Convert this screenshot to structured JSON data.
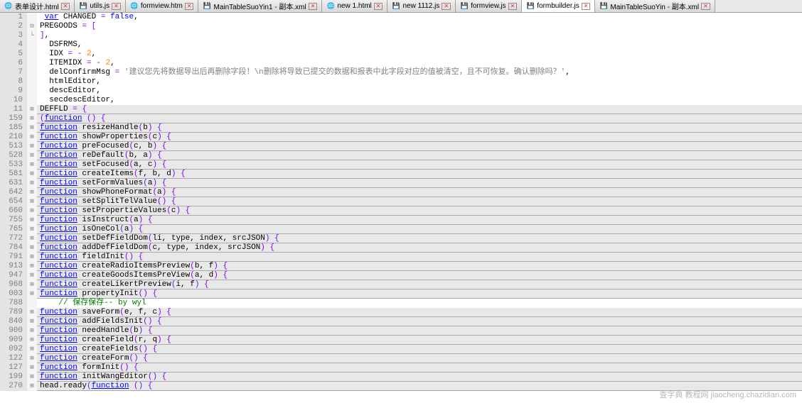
{
  "tabs": [
    {
      "label": "表单设计.html",
      "type": "html",
      "active": false
    },
    {
      "label": "utils.js",
      "type": "save",
      "active": false
    },
    {
      "label": "formview.htm",
      "type": "html",
      "active": false
    },
    {
      "label": "MainTableSuoYin1 - 副本.xml",
      "type": "save",
      "active": false
    },
    {
      "label": "new 1.html",
      "type": "html",
      "active": false
    },
    {
      "label": "new 1112.js",
      "type": "save",
      "active": false
    },
    {
      "label": "formview.js",
      "type": "save",
      "active": false
    },
    {
      "label": "formbuilder.js",
      "type": "save",
      "active": true
    },
    {
      "label": "MainTableSuoYin - 副本.xml",
      "type": "save",
      "active": false
    }
  ],
  "lines": [
    {
      "num": "1",
      "fold": "",
      "collapsed": false,
      "tokens": [
        {
          "t": " ",
          "c": ""
        },
        {
          "t": "var",
          "c": "kw2"
        },
        {
          "t": " CHANGED ",
          "c": ""
        },
        {
          "t": "=",
          "c": "op"
        },
        {
          "t": " ",
          "c": ""
        },
        {
          "t": "false",
          "c": "kw1"
        },
        {
          "t": ",",
          "c": ""
        }
      ]
    },
    {
      "num": "2",
      "fold": "⊟",
      "collapsed": false,
      "tokens": [
        {
          "t": "PREGOODS ",
          "c": ""
        },
        {
          "t": "=",
          "c": "op"
        },
        {
          "t": " ",
          "c": ""
        },
        {
          "t": "[",
          "c": "op"
        }
      ]
    },
    {
      "num": "3",
      "fold": "└",
      "collapsed": false,
      "tokens": [
        {
          "t": "]",
          "c": "op"
        },
        {
          "t": ",",
          "c": ""
        }
      ]
    },
    {
      "num": "4",
      "fold": "",
      "collapsed": false,
      "tokens": [
        {
          "t": "  DSFRMS,",
          "c": ""
        }
      ]
    },
    {
      "num": "5",
      "fold": "",
      "collapsed": false,
      "tokens": [
        {
          "t": "  IDX ",
          "c": ""
        },
        {
          "t": "=",
          "c": "op"
        },
        {
          "t": " ",
          "c": ""
        },
        {
          "t": "-",
          "c": "op"
        },
        {
          "t": " ",
          "c": ""
        },
        {
          "t": "2",
          "c": "num"
        },
        {
          "t": ",",
          "c": ""
        }
      ]
    },
    {
      "num": "6",
      "fold": "",
      "collapsed": false,
      "tokens": [
        {
          "t": "  ITEMIDX ",
          "c": ""
        },
        {
          "t": "=",
          "c": "op"
        },
        {
          "t": " ",
          "c": ""
        },
        {
          "t": "-",
          "c": "op"
        },
        {
          "t": " ",
          "c": ""
        },
        {
          "t": "2",
          "c": "num"
        },
        {
          "t": ",",
          "c": ""
        }
      ]
    },
    {
      "num": "7",
      "fold": "",
      "collapsed": false,
      "tokens": [
        {
          "t": "  delConfirmMsg ",
          "c": ""
        },
        {
          "t": "=",
          "c": "op"
        },
        {
          "t": " ",
          "c": ""
        },
        {
          "t": "'建议您先将数据导出后再删除字段！\\n删除将导致已提交的数据和报表中此字段对应的值被清空，且不可恢复。确认删除吗？'",
          "c": "str"
        },
        {
          "t": ",",
          "c": ""
        }
      ]
    },
    {
      "num": "8",
      "fold": "",
      "collapsed": false,
      "tokens": [
        {
          "t": "  htmlEditor,",
          "c": ""
        }
      ]
    },
    {
      "num": "9",
      "fold": "",
      "collapsed": false,
      "tokens": [
        {
          "t": "  descEditor,",
          "c": ""
        }
      ]
    },
    {
      "num": "10",
      "fold": "",
      "collapsed": false,
      "tokens": [
        {
          "t": "  secdescEditor,",
          "c": ""
        }
      ]
    },
    {
      "num": "11",
      "fold": "⊞",
      "collapsed": true,
      "tokens": [
        {
          "t": "DEFFLD ",
          "c": ""
        },
        {
          "t": "=",
          "c": "op"
        },
        {
          "t": " ",
          "c": ""
        },
        {
          "t": "{",
          "c": "op"
        }
      ]
    },
    {
      "num": "159",
      "fold": "⊞",
      "collapsed": true,
      "tokens": [
        {
          "t": "(",
          "c": "op"
        },
        {
          "t": "function",
          "c": "kw2"
        },
        {
          "t": " ",
          "c": ""
        },
        {
          "t": "()",
          "c": "op"
        },
        {
          "t": " ",
          "c": ""
        },
        {
          "t": "{",
          "c": "op"
        }
      ]
    },
    {
      "num": "185",
      "fold": "⊞",
      "collapsed": true,
      "tokens": [
        {
          "t": "function",
          "c": "kw2"
        },
        {
          "t": " resizeHandle",
          "c": ""
        },
        {
          "t": "(",
          "c": "op"
        },
        {
          "t": "b",
          "c": ""
        },
        {
          "t": ")",
          "c": "op"
        },
        {
          "t": " ",
          "c": ""
        },
        {
          "t": "{",
          "c": "op"
        }
      ]
    },
    {
      "num": "210",
      "fold": "⊞",
      "collapsed": true,
      "tokens": [
        {
          "t": "function",
          "c": "kw2"
        },
        {
          "t": " showProperties",
          "c": ""
        },
        {
          "t": "(",
          "c": "op"
        },
        {
          "t": "c",
          "c": ""
        },
        {
          "t": ")",
          "c": "op"
        },
        {
          "t": " ",
          "c": ""
        },
        {
          "t": "{",
          "c": "op"
        }
      ]
    },
    {
      "num": "513",
      "fold": "⊞",
      "collapsed": true,
      "tokens": [
        {
          "t": "function",
          "c": "kw2"
        },
        {
          "t": " preFocused",
          "c": ""
        },
        {
          "t": "(",
          "c": "op"
        },
        {
          "t": "c, b",
          "c": ""
        },
        {
          "t": ")",
          "c": "op"
        },
        {
          "t": " ",
          "c": ""
        },
        {
          "t": "{",
          "c": "op"
        }
      ]
    },
    {
      "num": "528",
      "fold": "⊞",
      "collapsed": true,
      "tokens": [
        {
          "t": "function",
          "c": "kw2"
        },
        {
          "t": " reDefault",
          "c": ""
        },
        {
          "t": "(",
          "c": "op"
        },
        {
          "t": "b, a",
          "c": ""
        },
        {
          "t": ")",
          "c": "op"
        },
        {
          "t": " ",
          "c": ""
        },
        {
          "t": "{",
          "c": "op"
        }
      ]
    },
    {
      "num": "533",
      "fold": "⊞",
      "collapsed": true,
      "tokens": [
        {
          "t": "function",
          "c": "kw2"
        },
        {
          "t": " setFocused",
          "c": ""
        },
        {
          "t": "(",
          "c": "op"
        },
        {
          "t": "a, c",
          "c": ""
        },
        {
          "t": ")",
          "c": "op"
        },
        {
          "t": " ",
          "c": ""
        },
        {
          "t": "{",
          "c": "op"
        }
      ]
    },
    {
      "num": "581",
      "fold": "⊞",
      "collapsed": true,
      "tokens": [
        {
          "t": "function",
          "c": "kw2"
        },
        {
          "t": " createItems",
          "c": ""
        },
        {
          "t": "(",
          "c": "op"
        },
        {
          "t": "f, b, d",
          "c": ""
        },
        {
          "t": ")",
          "c": "op"
        },
        {
          "t": " ",
          "c": ""
        },
        {
          "t": "{",
          "c": "op"
        }
      ]
    },
    {
      "num": "631",
      "fold": "⊞",
      "collapsed": true,
      "tokens": [
        {
          "t": "function",
          "c": "kw2"
        },
        {
          "t": " setFormValues",
          "c": ""
        },
        {
          "t": "(",
          "c": "op"
        },
        {
          "t": "a",
          "c": ""
        },
        {
          "t": ")",
          "c": "op"
        },
        {
          "t": " ",
          "c": ""
        },
        {
          "t": "{",
          "c": "op"
        }
      ]
    },
    {
      "num": "642",
      "fold": "⊞",
      "collapsed": true,
      "tokens": [
        {
          "t": "function",
          "c": "kw2"
        },
        {
          "t": " showPhoneFormat",
          "c": ""
        },
        {
          "t": "(",
          "c": "op"
        },
        {
          "t": "a",
          "c": ""
        },
        {
          "t": ")",
          "c": "op"
        },
        {
          "t": " ",
          "c": ""
        },
        {
          "t": "{",
          "c": "op"
        }
      ]
    },
    {
      "num": "654",
      "fold": "⊞",
      "collapsed": true,
      "tokens": [
        {
          "t": "function",
          "c": "kw2"
        },
        {
          "t": " setSplitTelValue",
          "c": ""
        },
        {
          "t": "()",
          "c": "op"
        },
        {
          "t": " ",
          "c": ""
        },
        {
          "t": "{",
          "c": "op"
        }
      ]
    },
    {
      "num": "660",
      "fold": "⊞",
      "collapsed": true,
      "tokens": [
        {
          "t": "function",
          "c": "kw2"
        },
        {
          "t": " setPropertieValues",
          "c": ""
        },
        {
          "t": "(",
          "c": "op"
        },
        {
          "t": "c",
          "c": ""
        },
        {
          "t": ")",
          "c": "op"
        },
        {
          "t": " ",
          "c": ""
        },
        {
          "t": "{",
          "c": "op"
        }
      ]
    },
    {
      "num": "755",
      "fold": "⊞",
      "collapsed": true,
      "tokens": [
        {
          "t": "function",
          "c": "kw2"
        },
        {
          "t": " isInstruct",
          "c": ""
        },
        {
          "t": "(",
          "c": "op"
        },
        {
          "t": "a",
          "c": ""
        },
        {
          "t": ")",
          "c": "op"
        },
        {
          "t": " ",
          "c": ""
        },
        {
          "t": "{",
          "c": "op"
        }
      ]
    },
    {
      "num": "765",
      "fold": "⊞",
      "collapsed": true,
      "tokens": [
        {
          "t": "function",
          "c": "kw2"
        },
        {
          "t": " isOneCol",
          "c": ""
        },
        {
          "t": "(",
          "c": "op"
        },
        {
          "t": "a",
          "c": ""
        },
        {
          "t": ")",
          "c": "op"
        },
        {
          "t": " ",
          "c": ""
        },
        {
          "t": "{",
          "c": "op"
        }
      ]
    },
    {
      "num": "772",
      "fold": "⊞",
      "collapsed": true,
      "tokens": [
        {
          "t": "function",
          "c": "kw2"
        },
        {
          "t": " setDefFieldDom",
          "c": ""
        },
        {
          "t": "(",
          "c": "op"
        },
        {
          "t": "li, type, index, srcJSON",
          "c": ""
        },
        {
          "t": ")",
          "c": "op"
        },
        {
          "t": " ",
          "c": ""
        },
        {
          "t": "{",
          "c": "op"
        }
      ]
    },
    {
      "num": "784",
      "fold": "⊞",
      "collapsed": true,
      "tokens": [
        {
          "t": "function",
          "c": "kw2"
        },
        {
          "t": " addDefFieldDom",
          "c": ""
        },
        {
          "t": "(",
          "c": "op"
        },
        {
          "t": "c, type, index, srcJSON",
          "c": ""
        },
        {
          "t": ")",
          "c": "op"
        },
        {
          "t": " ",
          "c": ""
        },
        {
          "t": "{",
          "c": "op"
        }
      ]
    },
    {
      "num": "791",
      "fold": "⊞",
      "collapsed": true,
      "tokens": [
        {
          "t": "function",
          "c": "kw2"
        },
        {
          "t": " fieldInit",
          "c": ""
        },
        {
          "t": "()",
          "c": "op"
        },
        {
          "t": " ",
          "c": ""
        },
        {
          "t": "{",
          "c": "op"
        }
      ]
    },
    {
      "num": "913",
      "fold": "⊞",
      "collapsed": true,
      "tokens": [
        {
          "t": "function",
          "c": "kw2"
        },
        {
          "t": " createRadioItemsPreview",
          "c": ""
        },
        {
          "t": "(",
          "c": "op"
        },
        {
          "t": "b, f",
          "c": ""
        },
        {
          "t": ")",
          "c": "op"
        },
        {
          "t": " ",
          "c": ""
        },
        {
          "t": "{",
          "c": "op"
        }
      ]
    },
    {
      "num": "947",
      "fold": "⊞",
      "collapsed": true,
      "tokens": [
        {
          "t": "function",
          "c": "kw2"
        },
        {
          "t": " createGoodsItemsPreView",
          "c": ""
        },
        {
          "t": "(",
          "c": "op"
        },
        {
          "t": "a, d",
          "c": ""
        },
        {
          "t": ")",
          "c": "op"
        },
        {
          "t": " ",
          "c": ""
        },
        {
          "t": "{",
          "c": "op"
        }
      ]
    },
    {
      "num": "968",
      "fold": "⊞",
      "collapsed": true,
      "tokens": [
        {
          "t": "function",
          "c": "kw2"
        },
        {
          "t": " createLikertPreview",
          "c": ""
        },
        {
          "t": "(",
          "c": "op"
        },
        {
          "t": "i, f",
          "c": ""
        },
        {
          "t": ")",
          "c": "op"
        },
        {
          "t": " ",
          "c": ""
        },
        {
          "t": "{",
          "c": "op"
        }
      ]
    },
    {
      "num": "003",
      "fold": "⊞",
      "collapsed": true,
      "tokens": [
        {
          "t": "function",
          "c": "kw2"
        },
        {
          "t": " propertyInit",
          "c": ""
        },
        {
          "t": "()",
          "c": "op"
        },
        {
          "t": " ",
          "c": ""
        },
        {
          "t": "{",
          "c": "op"
        }
      ]
    },
    {
      "num": "788",
      "fold": "",
      "collapsed": false,
      "tokens": [
        {
          "t": "    // 保存保存-- by wyl",
          "c": "cmt"
        }
      ]
    },
    {
      "num": "789",
      "fold": "⊞",
      "collapsed": true,
      "tokens": [
        {
          "t": "function",
          "c": "kw2"
        },
        {
          "t": " saveForm",
          "c": ""
        },
        {
          "t": "(",
          "c": "op"
        },
        {
          "t": "e, f, c",
          "c": ""
        },
        {
          "t": ")",
          "c": "op"
        },
        {
          "t": " ",
          "c": ""
        },
        {
          "t": "{",
          "c": "op"
        }
      ]
    },
    {
      "num": "840",
      "fold": "⊞",
      "collapsed": true,
      "tokens": [
        {
          "t": "function",
          "c": "kw2"
        },
        {
          "t": " addFieldsInit",
          "c": ""
        },
        {
          "t": "()",
          "c": "op"
        },
        {
          "t": " ",
          "c": ""
        },
        {
          "t": "{",
          "c": "op"
        }
      ]
    },
    {
      "num": "900",
      "fold": "⊞",
      "collapsed": true,
      "tokens": [
        {
          "t": "function",
          "c": "kw2"
        },
        {
          "t": " needHandle",
          "c": ""
        },
        {
          "t": "(",
          "c": "op"
        },
        {
          "t": "b",
          "c": ""
        },
        {
          "t": ")",
          "c": "op"
        },
        {
          "t": " ",
          "c": ""
        },
        {
          "t": "{",
          "c": "op"
        }
      ]
    },
    {
      "num": "909",
      "fold": "⊞",
      "collapsed": true,
      "tokens": [
        {
          "t": "function",
          "c": "kw2"
        },
        {
          "t": " createField",
          "c": ""
        },
        {
          "t": "(",
          "c": "op"
        },
        {
          "t": "r, q",
          "c": ""
        },
        {
          "t": ")",
          "c": "op"
        },
        {
          "t": " ",
          "c": ""
        },
        {
          "t": "{",
          "c": "op"
        }
      ]
    },
    {
      "num": "092",
      "fold": "⊞",
      "collapsed": true,
      "tokens": [
        {
          "t": "function",
          "c": "kw2"
        },
        {
          "t": " createFields",
          "c": ""
        },
        {
          "t": "()",
          "c": "op"
        },
        {
          "t": " ",
          "c": ""
        },
        {
          "t": "{",
          "c": "op"
        }
      ]
    },
    {
      "num": "122",
      "fold": "⊞",
      "collapsed": true,
      "tokens": [
        {
          "t": "function",
          "c": "kw2"
        },
        {
          "t": " createForm",
          "c": ""
        },
        {
          "t": "()",
          "c": "op"
        },
        {
          "t": " ",
          "c": ""
        },
        {
          "t": "{",
          "c": "op"
        }
      ]
    },
    {
      "num": "127",
      "fold": "⊞",
      "collapsed": true,
      "tokens": [
        {
          "t": "function",
          "c": "kw2"
        },
        {
          "t": " formInit",
          "c": ""
        },
        {
          "t": "()",
          "c": "op"
        },
        {
          "t": " ",
          "c": ""
        },
        {
          "t": "{",
          "c": "op"
        }
      ]
    },
    {
      "num": "199",
      "fold": "⊞",
      "collapsed": true,
      "tokens": [
        {
          "t": "function",
          "c": "kw2"
        },
        {
          "t": " initWangEditor",
          "c": ""
        },
        {
          "t": "()",
          "c": "op"
        },
        {
          "t": " ",
          "c": ""
        },
        {
          "t": "{",
          "c": "op"
        }
      ]
    },
    {
      "num": "270",
      "fold": "⊞",
      "collapsed": true,
      "tokens": [
        {
          "t": "head.ready",
          "c": ""
        },
        {
          "t": "(",
          "c": "op"
        },
        {
          "t": "function",
          "c": "kw2"
        },
        {
          "t": " ",
          "c": ""
        },
        {
          "t": "()",
          "c": "op"
        },
        {
          "t": " ",
          "c": ""
        },
        {
          "t": "{",
          "c": "op"
        }
      ]
    }
  ],
  "watermark": "查字典 教程网\njiaocheng.chazidian.com"
}
